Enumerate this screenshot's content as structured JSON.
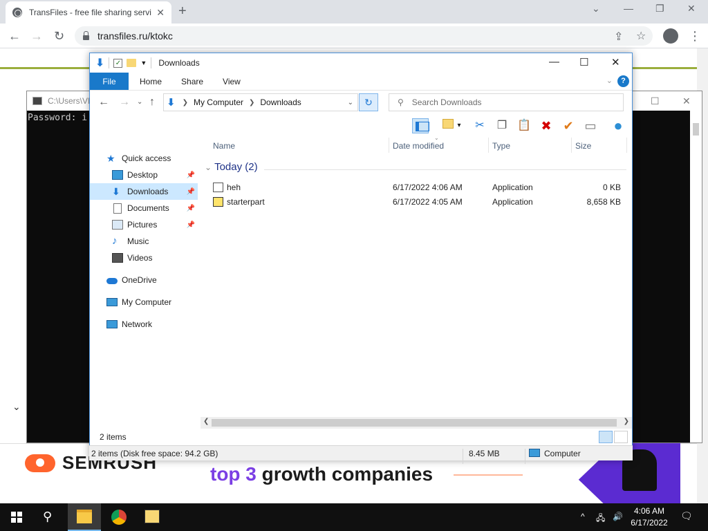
{
  "browser": {
    "tab_title": "TransFiles - free file sharing servi",
    "url": "transfiles.ru/ktokc",
    "tab_close": "✕",
    "new_tab": "+",
    "win_min": "⌄",
    "win_minimize": "—",
    "win_restore": "❐",
    "win_close": "✕",
    "back": "←",
    "forward": "→",
    "reload": "↻",
    "share": "⇪",
    "star": "☆",
    "menu": "⋮"
  },
  "webpage": {
    "collapse_chevron": "⌄",
    "ad_brand": "SEMRUSH",
    "ad_highlight": "top 3",
    "ad_text": " growth companies"
  },
  "console": {
    "title": "C:\\Users\\VM",
    "text": "Password: i",
    "restore": "☐",
    "close": "✕"
  },
  "explorer": {
    "title": "Downloads",
    "window_min": "—",
    "window_max": "☐",
    "window_close": "✕",
    "ribbon": {
      "file": "File",
      "tabs": [
        "Home",
        "Share",
        "View"
      ],
      "expand": "⌄",
      "help": "?"
    },
    "address": {
      "back": "←",
      "forward": "→",
      "recent": "⌄",
      "up": "↑",
      "crumbs": [
        "My Computer",
        "Downloads"
      ],
      "crumb_sep": "❯",
      "dropdown": "⌄",
      "refresh": "↻"
    },
    "search_placeholder": "Search Downloads",
    "toolbar": {
      "dropdown": "▾",
      "cut": "✂",
      "copy": "❐",
      "paste": "📋",
      "delete": "✖",
      "rename": "✔",
      "properties": "▭",
      "globe": "●"
    },
    "nav": {
      "quick_access": "Quick access",
      "desktop": "Desktop",
      "downloads": "Downloads",
      "documents": "Documents",
      "pictures": "Pictures",
      "music": "Music",
      "videos": "Videos",
      "onedrive": "OneDrive",
      "my_computer": "My Computer",
      "network": "Network",
      "pin": "📌"
    },
    "columns": {
      "name": "Name",
      "date": "Date modified",
      "type": "Type",
      "size": "Size"
    },
    "group": {
      "label": "Today (2)",
      "chevron": "⌄"
    },
    "files": [
      {
        "name": "heh",
        "date": "6/17/2022 4:06 AM",
        "type": "Application",
        "size": "0 KB"
      },
      {
        "name": "starterpart",
        "date": "6/17/2022 4:05 AM",
        "type": "Application",
        "size": "8,658 KB"
      }
    ],
    "scroll_left": "❮",
    "scroll_right": "❯",
    "item_count": "2 items"
  },
  "bottom_status": {
    "items": "2 items (Disk free space: 94.2 GB)",
    "size": "8.45 MB",
    "location": "Computer"
  },
  "taskbar": {
    "search": "⚲",
    "tray_chevron": "^",
    "tray_network": "🖧",
    "tray_volume": "🔊",
    "time": "4:06 AM",
    "date": "6/17/2022",
    "notification": "🗨"
  },
  "colors": {
    "accent": "#1979ca",
    "selected": "#cce8ff",
    "group_heading": "#1e3287",
    "taskbar": "#101010"
  }
}
